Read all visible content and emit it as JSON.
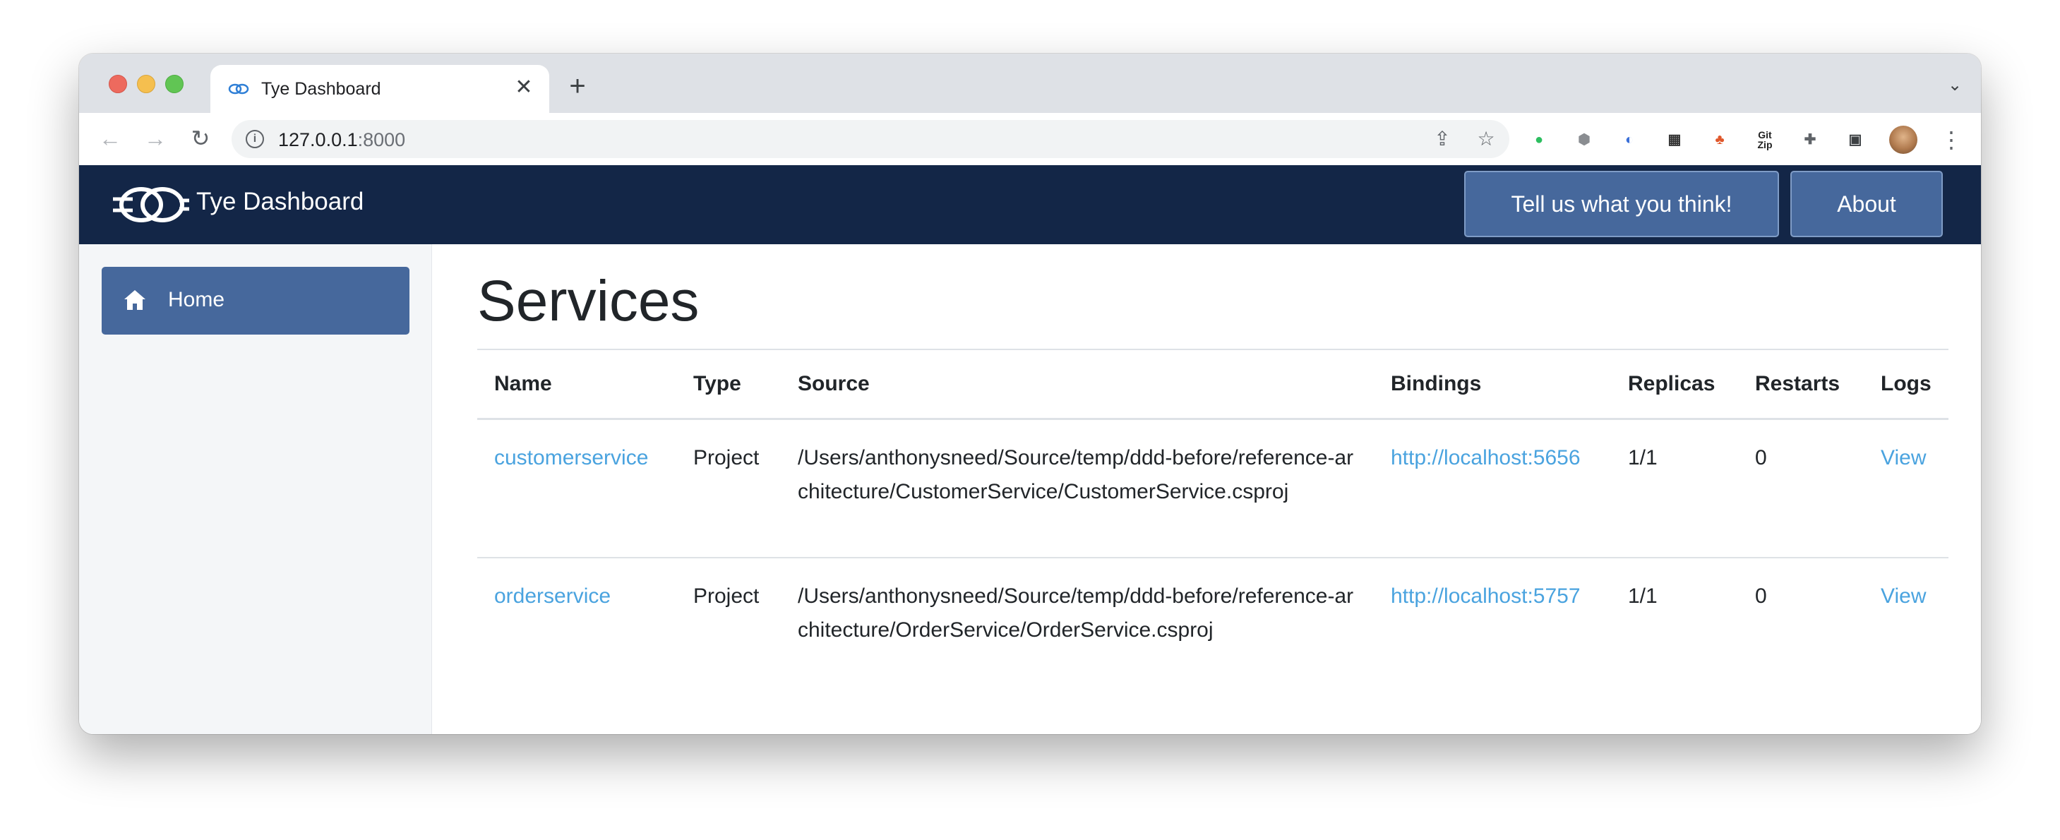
{
  "browser": {
    "tab_title": "Tye Dashboard",
    "url_host": "127.0.0.1",
    "url_port": ":8000"
  },
  "header": {
    "title": "Tye Dashboard",
    "feedback_label": "Tell us what you think!",
    "about_label": "About",
    "background_color": "#132647",
    "button_color": "#46689c"
  },
  "sidebar": {
    "items": [
      {
        "label": "Home",
        "icon": "home-icon",
        "active": true
      }
    ]
  },
  "main": {
    "title": "Services",
    "table": {
      "columns": [
        "Name",
        "Type",
        "Source",
        "Bindings",
        "Replicas",
        "Restarts",
        "Logs"
      ],
      "rows": [
        {
          "name": "customerservice",
          "type": "Project",
          "source": "/Users/anthonysneed/Source/temp/ddd-before/reference-architecture/CustomerService/CustomerService.csproj",
          "binding": "http://localhost:5656",
          "replicas": "1/1",
          "restarts": "0",
          "logs": "View"
        },
        {
          "name": "orderservice",
          "type": "Project",
          "source": "/Users/anthonysneed/Source/temp/ddd-before/reference-architecture/OrderService/OrderService.csproj",
          "binding": "http://localhost:5757",
          "replicas": "1/1",
          "restarts": "0",
          "logs": "View"
        }
      ]
    },
    "link_color": "#4aa3df"
  }
}
